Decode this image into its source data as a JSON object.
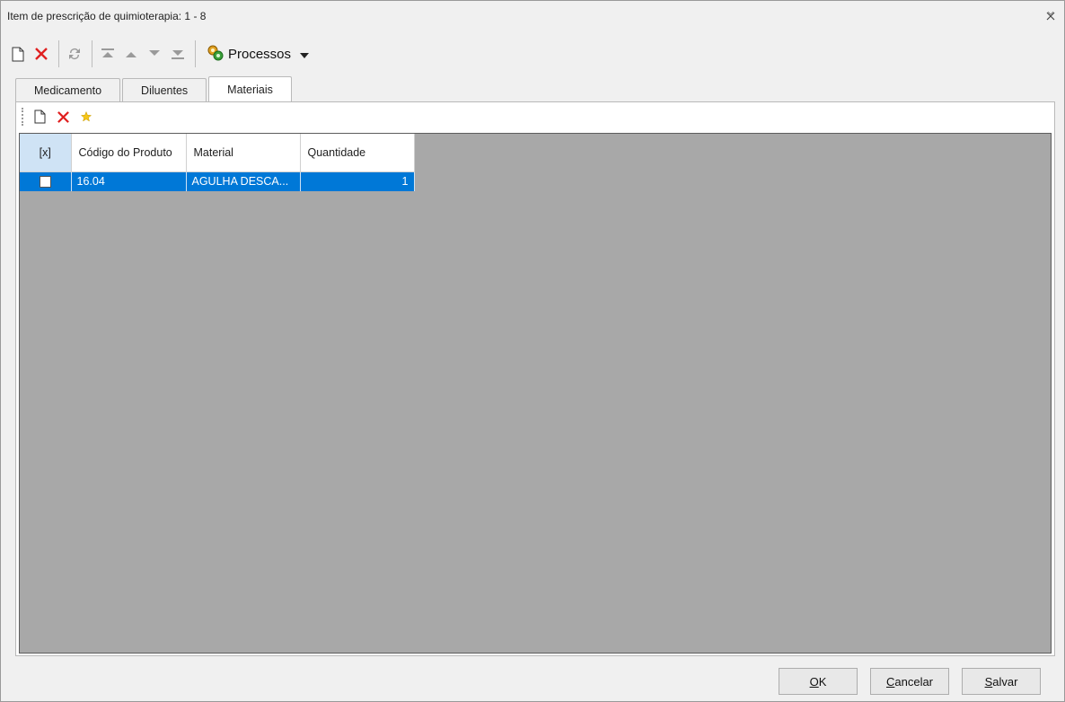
{
  "window": {
    "title": "Item de prescrição de quimioterapia: 1 - 8"
  },
  "toolbar": {
    "processos_label": "Processos"
  },
  "tabs": [
    {
      "label": "Medicamento"
    },
    {
      "label": "Diluentes"
    },
    {
      "label": "Materiais",
      "active": true
    }
  ],
  "grid": {
    "columns": [
      "[x]",
      "Código do Produto",
      "Material",
      "Quantidade"
    ],
    "rows": [
      {
        "checked": false,
        "codigo": "16.04",
        "material": "AGULHA DESCA...",
        "quantidade": "1"
      }
    ]
  },
  "footer": {
    "ok": {
      "accel": "O",
      "rest": "K"
    },
    "cancelar": {
      "accel": "C",
      "rest": "ancelar"
    },
    "salvar": {
      "accel": "S",
      "rest": "alvar"
    }
  },
  "colors": {
    "selection": "#0078d7",
    "grid_bg": "#a8a8a8",
    "delete_red": "#e02020"
  }
}
